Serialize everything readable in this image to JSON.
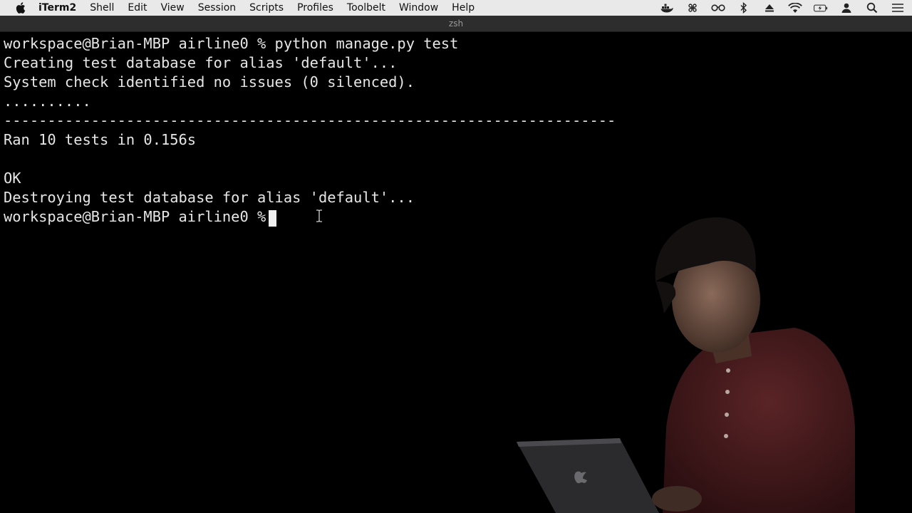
{
  "menubar": {
    "app_name": "iTerm2",
    "items": [
      "Shell",
      "Edit",
      "View",
      "Session",
      "Scripts",
      "Profiles",
      "Toolbelt",
      "Window",
      "Help"
    ],
    "status_icons": [
      "docker-icon",
      "command-key-icon",
      "glasses-icon",
      "bluetooth-icon",
      "eject-icon",
      "wifi-icon",
      "battery-icon",
      "user-icon",
      "search-icon",
      "control-center-icon"
    ]
  },
  "window": {
    "title": "zsh"
  },
  "terminal": {
    "lines": [
      "workspace@Brian-MBP airline0 % python manage.py test",
      "Creating test database for alias 'default'...",
      "System check identified no issues (0 silenced).",
      "..........",
      "----------------------------------------------------------------------",
      "Ran 10 tests in 0.156s",
      "",
      "OK",
      "Destroying test database for alias 'default'...",
      "workspace@Brian-MBP airline0 % "
    ]
  },
  "colors": {
    "background": "#000000",
    "text": "#e6e6e6",
    "menubar": "#e9e9e9",
    "titlebar": "#2d2d2d",
    "presenter_shirt": "#4a1d1f"
  }
}
